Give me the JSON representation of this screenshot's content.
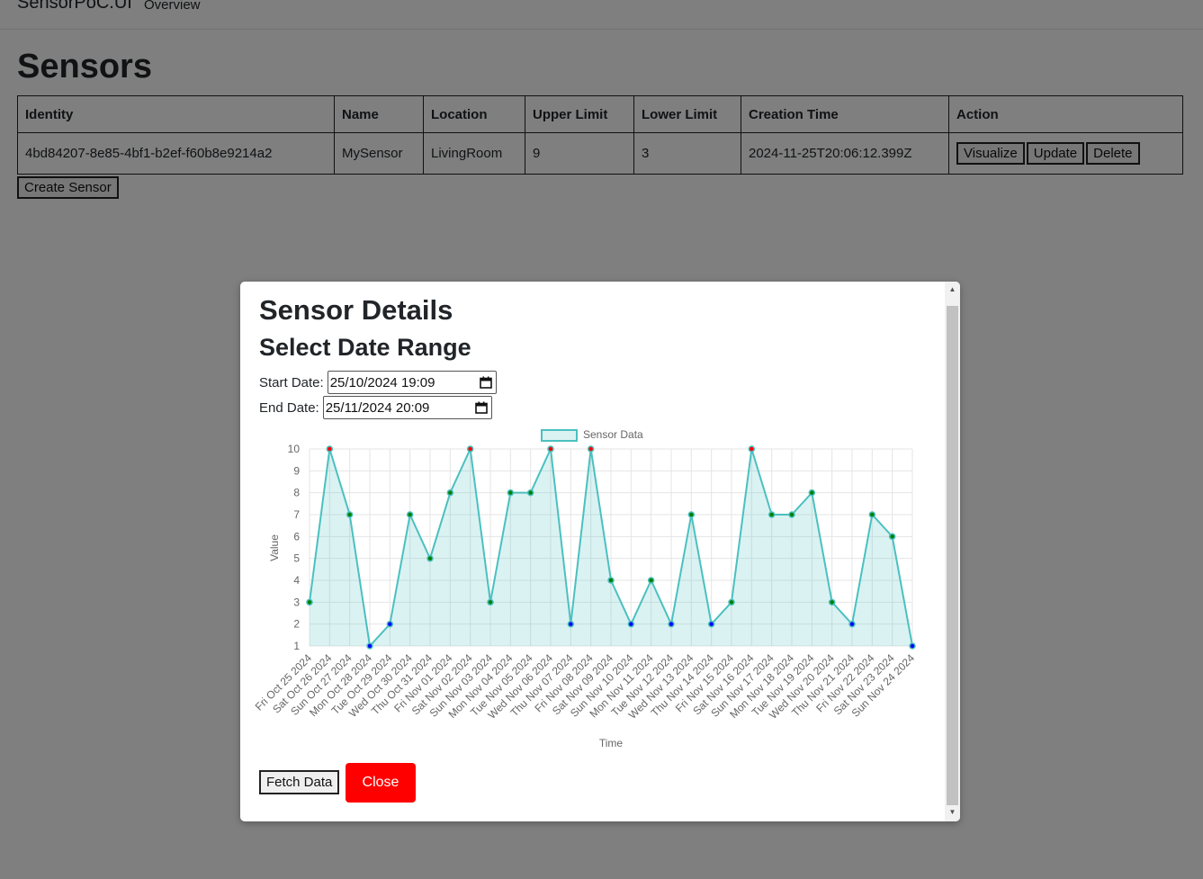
{
  "nav": {
    "brand": "SensorPoC.UI",
    "link": "Overview"
  },
  "page": {
    "title": "Sensors"
  },
  "table": {
    "headers": [
      "Identity",
      "Name",
      "Location",
      "Upper Limit",
      "Lower Limit",
      "Creation Time",
      "Action"
    ],
    "rows": [
      {
        "identity": "4bd84207-8e85-4bf1-b2ef-f60b8e9214a2",
        "name": "MySensor",
        "location": "LivingRoom",
        "upper": "9",
        "lower": "3",
        "created": "2024-11-25T20:06:12.399Z"
      }
    ],
    "actions": {
      "visualize": "Visualize",
      "update": "Update",
      "delete": "Delete"
    }
  },
  "create_button": "Create Sensor",
  "modal": {
    "title": "Sensor Details",
    "subtitle": "Select Date Range",
    "start_label": "Start Date:",
    "start_value": "25/10/2024 19:09",
    "end_label": "End Date:",
    "end_value": "25/11/2024 20:09",
    "fetch_button": "Fetch Data",
    "close_button": "Close"
  },
  "colors": {
    "line": "#4bc0c0",
    "fill": "rgba(75,192,192,0.2)",
    "above_upper": "#ff0000",
    "below_lower": "#0000ff",
    "normal": "#008000",
    "close": "#ff0000"
  },
  "chart_data": {
    "type": "area",
    "legend": "Sensor Data",
    "legend_position": "top",
    "xlabel": "Time",
    "ylabel": "Value",
    "ylim": [
      1,
      10
    ],
    "yticks": [
      1,
      2,
      3,
      4,
      5,
      6,
      7,
      8,
      9,
      10
    ],
    "grid": true,
    "categories": [
      "Fri Oct 25 2024",
      "Sat Oct 26 2024",
      "Sun Oct 27 2024",
      "Mon Oct 28 2024",
      "Tue Oct 29 2024",
      "Wed Oct 30 2024",
      "Thu Oct 31 2024",
      "Fri Nov 01 2024",
      "Sat Nov 02 2024",
      "Sun Nov 03 2024",
      "Mon Nov 04 2024",
      "Tue Nov 05 2024",
      "Wed Nov 06 2024",
      "Thu Nov 07 2024",
      "Fri Nov 08 2024",
      "Sat Nov 09 2024",
      "Sun Nov 10 2024",
      "Mon Nov 11 2024",
      "Tue Nov 12 2024",
      "Wed Nov 13 2024",
      "Thu Nov 14 2024",
      "Fri Nov 15 2024",
      "Sat Nov 16 2024",
      "Sun Nov 17 2024",
      "Mon Nov 18 2024",
      "Tue Nov 19 2024",
      "Wed Nov 20 2024",
      "Thu Nov 21 2024",
      "Fri Nov 22 2024",
      "Sat Nov 23 2024",
      "Sun Nov 24 2024"
    ],
    "series": [
      {
        "name": "Sensor Data",
        "values": [
          3,
          10,
          7,
          1,
          2,
          7,
          5,
          8,
          10,
          3,
          8,
          8,
          10,
          2,
          10,
          4,
          2,
          4,
          2,
          7,
          2,
          3,
          10,
          7,
          7,
          8,
          3,
          2,
          7,
          6,
          1
        ]
      }
    ]
  }
}
